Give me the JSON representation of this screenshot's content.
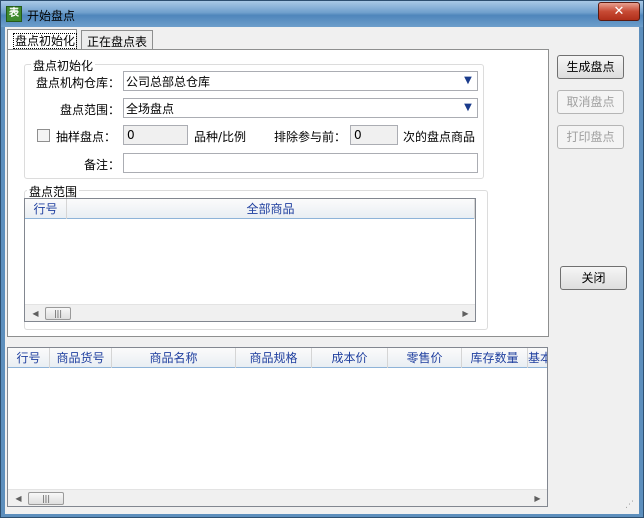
{
  "window": {
    "title": "开始盘点",
    "close_glyph": "✕"
  },
  "tabs": [
    {
      "label": "盘点初始化",
      "active": true
    },
    {
      "label": "正在盘点表",
      "active": false
    }
  ],
  "init_group": {
    "title": "盘点初始化",
    "warehouse": {
      "label": "盘点机构仓库：",
      "value": "公司总部总仓库"
    },
    "scope": {
      "label": "盘点范围：",
      "value": "全场盘点"
    },
    "sampling": {
      "label": "抽样盘点：",
      "value": "0",
      "unit": "品种/比例"
    },
    "exclude": {
      "label": "排除参与前：",
      "value": "0",
      "suffix": "次的盘点商品"
    },
    "remark": {
      "label": "备注：",
      "value": ""
    }
  },
  "scope_group": {
    "title": "盘点范围",
    "columns": [
      "行号",
      "全部商品"
    ]
  },
  "bottom_grid": {
    "columns": [
      "行号",
      "商品货号",
      "商品名称",
      "商品规格",
      "成本价",
      "零售价",
      "库存数量",
      "基本"
    ]
  },
  "buttons": {
    "generate": "生成盘点",
    "cancel": "取消盘点",
    "print": "打印盘点",
    "close": "关闭"
  },
  "scroll": {
    "left": "◀",
    "right": "▶",
    "thumb": "|||"
  },
  "icons": {
    "app": "app-icon",
    "dropdown": "▼"
  }
}
